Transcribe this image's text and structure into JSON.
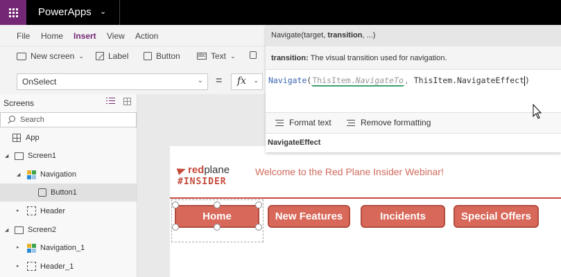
{
  "app": {
    "name": "PowerApps"
  },
  "menu": [
    {
      "label": "File"
    },
    {
      "label": "Home"
    },
    {
      "label": "Insert",
      "active": true
    },
    {
      "label": "View"
    },
    {
      "label": "Action"
    }
  ],
  "toolbar": {
    "new_screen": "New screen",
    "label": "Label",
    "button": "Button",
    "text": "Text"
  },
  "property_bar": {
    "property": "OnSelect",
    "equals": "=",
    "fx": "fx"
  },
  "formula": {
    "signature_prefix": "Navigate(target, ",
    "signature_bold": "transition",
    "signature_suffix": ", ...)",
    "desc_bold": "transition:",
    "desc_text": " The visual transition used for navigation.",
    "code_fn": "Navigate",
    "code_open": "(",
    "code_arg1_obj": "ThisItem.",
    "code_arg1_prop": "NavigateTo",
    "code_sep": ", ",
    "code_arg2": "ThisItem.NavigateEffect",
    "code_close": ")",
    "format_text": "Format text",
    "remove_formatting": "Remove formatting",
    "suggestion": "NavigateEffect"
  },
  "tree": {
    "header": "Screens",
    "search_placeholder": "Search",
    "items": [
      {
        "label": "App"
      },
      {
        "label": "Screen1"
      },
      {
        "label": "Navigation"
      },
      {
        "label": "Button1"
      },
      {
        "label": "Header"
      },
      {
        "label": "Screen2"
      },
      {
        "label": "Navigation_1"
      },
      {
        "label": "Header_1"
      }
    ]
  },
  "canvas": {
    "logo_red": "red",
    "logo_plane": "plane",
    "logo_tag": "#INSIDER",
    "welcome": "Welcome to the Red Plane Insider Webinar!",
    "nav_buttons": [
      {
        "label": "Home"
      },
      {
        "label": "New Features"
      },
      {
        "label": "Incidents"
      },
      {
        "label": "Special Offers"
      }
    ]
  },
  "colors": {
    "brand_purple": "#742774",
    "accent_red": "#d8685a"
  }
}
